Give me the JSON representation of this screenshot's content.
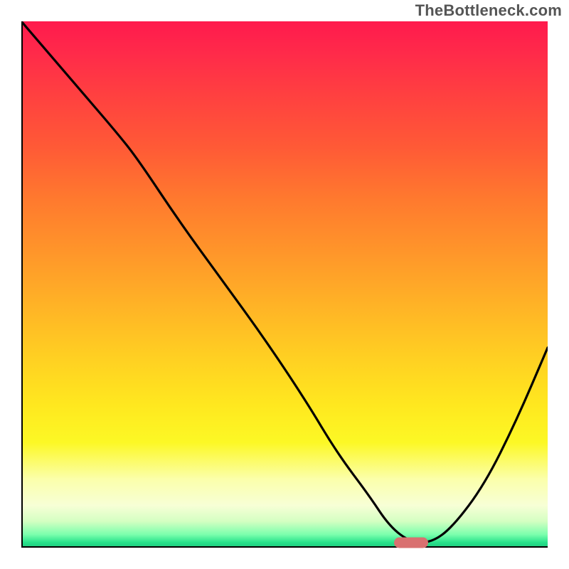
{
  "watermark": "TheBottleneck.com",
  "chart_data": {
    "type": "line",
    "title": "",
    "xlabel": "",
    "ylabel": "",
    "xlim": [
      0,
      100
    ],
    "ylim": [
      0,
      100
    ],
    "grid": false,
    "legend": false,
    "background_gradient": {
      "top": "#ff1a4d",
      "middle": "#ffe81f",
      "bottom": "#1fc97e"
    },
    "series": [
      {
        "name": "bottleneck-curve",
        "color": "#000000",
        "x": [
          0,
          6,
          12,
          18,
          22,
          30,
          38,
          46,
          54,
          60,
          66,
          70,
          74,
          78,
          82,
          88,
          94,
          100
        ],
        "y": [
          100,
          93,
          86,
          79,
          74,
          62,
          51,
          40,
          28,
          18,
          10,
          4,
          1,
          1,
          4,
          12,
          24,
          38
        ]
      }
    ],
    "optimum_marker": {
      "x": 74,
      "y": 1,
      "color": "#d97070"
    }
  }
}
